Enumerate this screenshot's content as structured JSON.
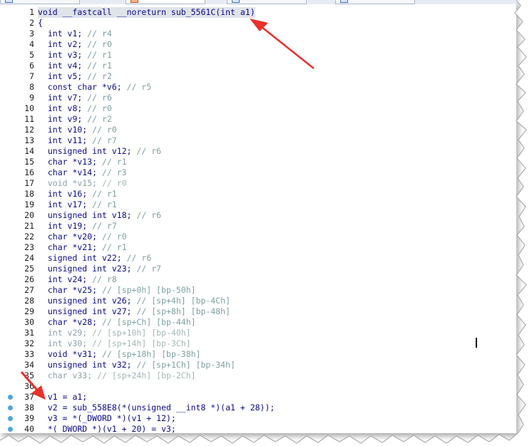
{
  "tabs": [
    {
      "label": "",
      "icon": "document-icon"
    },
    {
      "label": "",
      "icon": "pseudocode-icon"
    },
    {
      "label": "",
      "icon": "document-icon"
    },
    {
      "label": "",
      "icon": "document-icon"
    }
  ],
  "code_lines": [
    {
      "n": "1",
      "text": "void __fastcall __noreturn sub_5561C(int a1)",
      "comment": ""
    },
    {
      "n": "2",
      "text": "{",
      "comment": ""
    },
    {
      "n": "3",
      "text": "  int v1; ",
      "comment": "// r4"
    },
    {
      "n": "4",
      "text": "  int v2; ",
      "comment": "// r0"
    },
    {
      "n": "5",
      "text": "  int v3; ",
      "comment": "// r1"
    },
    {
      "n": "6",
      "text": "  int v4; ",
      "comment": "// r1"
    },
    {
      "n": "7",
      "text": "  int v5; ",
      "comment": "// r2"
    },
    {
      "n": "8",
      "text": "  const char *v6; ",
      "comment": "// r5"
    },
    {
      "n": "9",
      "text": "  int v7; ",
      "comment": "// r6"
    },
    {
      "n": "10",
      "text": "  int v8; ",
      "comment": "// r0"
    },
    {
      "n": "11",
      "text": "  int v9; ",
      "comment": "// r2"
    },
    {
      "n": "12",
      "text": "  int v10; ",
      "comment": "// r0"
    },
    {
      "n": "13",
      "text": "  int v11; ",
      "comment": "// r7"
    },
    {
      "n": "14",
      "text": "  unsigned int v12; ",
      "comment": "// r6"
    },
    {
      "n": "15",
      "text": "  char *v13; ",
      "comment": "// r1"
    },
    {
      "n": "16",
      "text": "  char *v14; ",
      "comment": "// r3"
    },
    {
      "n": "17",
      "text": "  void *v15; ",
      "comment": "// r0"
    },
    {
      "n": "18",
      "text": "  int v16; ",
      "comment": "// r1"
    },
    {
      "n": "19",
      "text": "  int v17; ",
      "comment": "// r1"
    },
    {
      "n": "20",
      "text": "  unsigned int v18; ",
      "comment": "// r6"
    },
    {
      "n": "21",
      "text": "  int v19; ",
      "comment": "// r7"
    },
    {
      "n": "22",
      "text": "  char *v20; ",
      "comment": "// r0"
    },
    {
      "n": "23",
      "text": "  char *v21; ",
      "comment": "// r1"
    },
    {
      "n": "24",
      "text": "  signed int v22; ",
      "comment": "// r6"
    },
    {
      "n": "25",
      "text": "  unsigned int v23; ",
      "comment": "// r7"
    },
    {
      "n": "26",
      "text": "  int v24; ",
      "comment": "// r8"
    },
    {
      "n": "27",
      "text": "  char *v25; ",
      "comment": "// [sp+0h] [bp-50h]"
    },
    {
      "n": "28",
      "text": "  unsigned int v26; ",
      "comment": "// [sp+4h] [bp-4Ch]"
    },
    {
      "n": "29",
      "text": "  unsigned int v27; ",
      "comment": "// [sp+8h] [bp-48h]"
    },
    {
      "n": "30",
      "text": "  char *v28; ",
      "comment": "// [sp+Ch] [bp-44h]"
    },
    {
      "n": "31",
      "text": "  int v29; ",
      "comment": "// [sp+10h] [bp-40h]"
    },
    {
      "n": "32",
      "text": "  int v30; ",
      "comment": "// [sp+14h] [bp-3Ch]"
    },
    {
      "n": "33",
      "text": "  void *v31; ",
      "comment": "// [sp+18h] [bp-38h]"
    },
    {
      "n": "34",
      "text": "  unsigned int v32; ",
      "comment": "// [sp+1Ch] [bp-34h]"
    },
    {
      "n": "35",
      "text": "  char v33; ",
      "comment": "// [sp+24h] [bp-2Ch]"
    },
    {
      "n": "36",
      "text": "",
      "comment": ""
    },
    {
      "n": "37",
      "text": "  v1 = a1;",
      "comment": ""
    },
    {
      "n": "38",
      "text": "  v2 = sub_558E8(*(unsigned __int8 *)(a1 + 28));",
      "comment": ""
    },
    {
      "n": "39",
      "text": "  v3 = *(_DWORD *)(v1 + 12);",
      "comment": ""
    },
    {
      "n": "40",
      "text": "  *(_DWORD *)(v1 + 20) = v3;",
      "comment": ""
    }
  ],
  "breakpoint_lines": [
    "37",
    "38",
    "39",
    "40"
  ],
  "colors": {
    "code_text": "#0a0a8a",
    "comment": "#7ea0a0",
    "breakpoint_dot": "#4ea5e4",
    "arrow": "#e8312a"
  }
}
